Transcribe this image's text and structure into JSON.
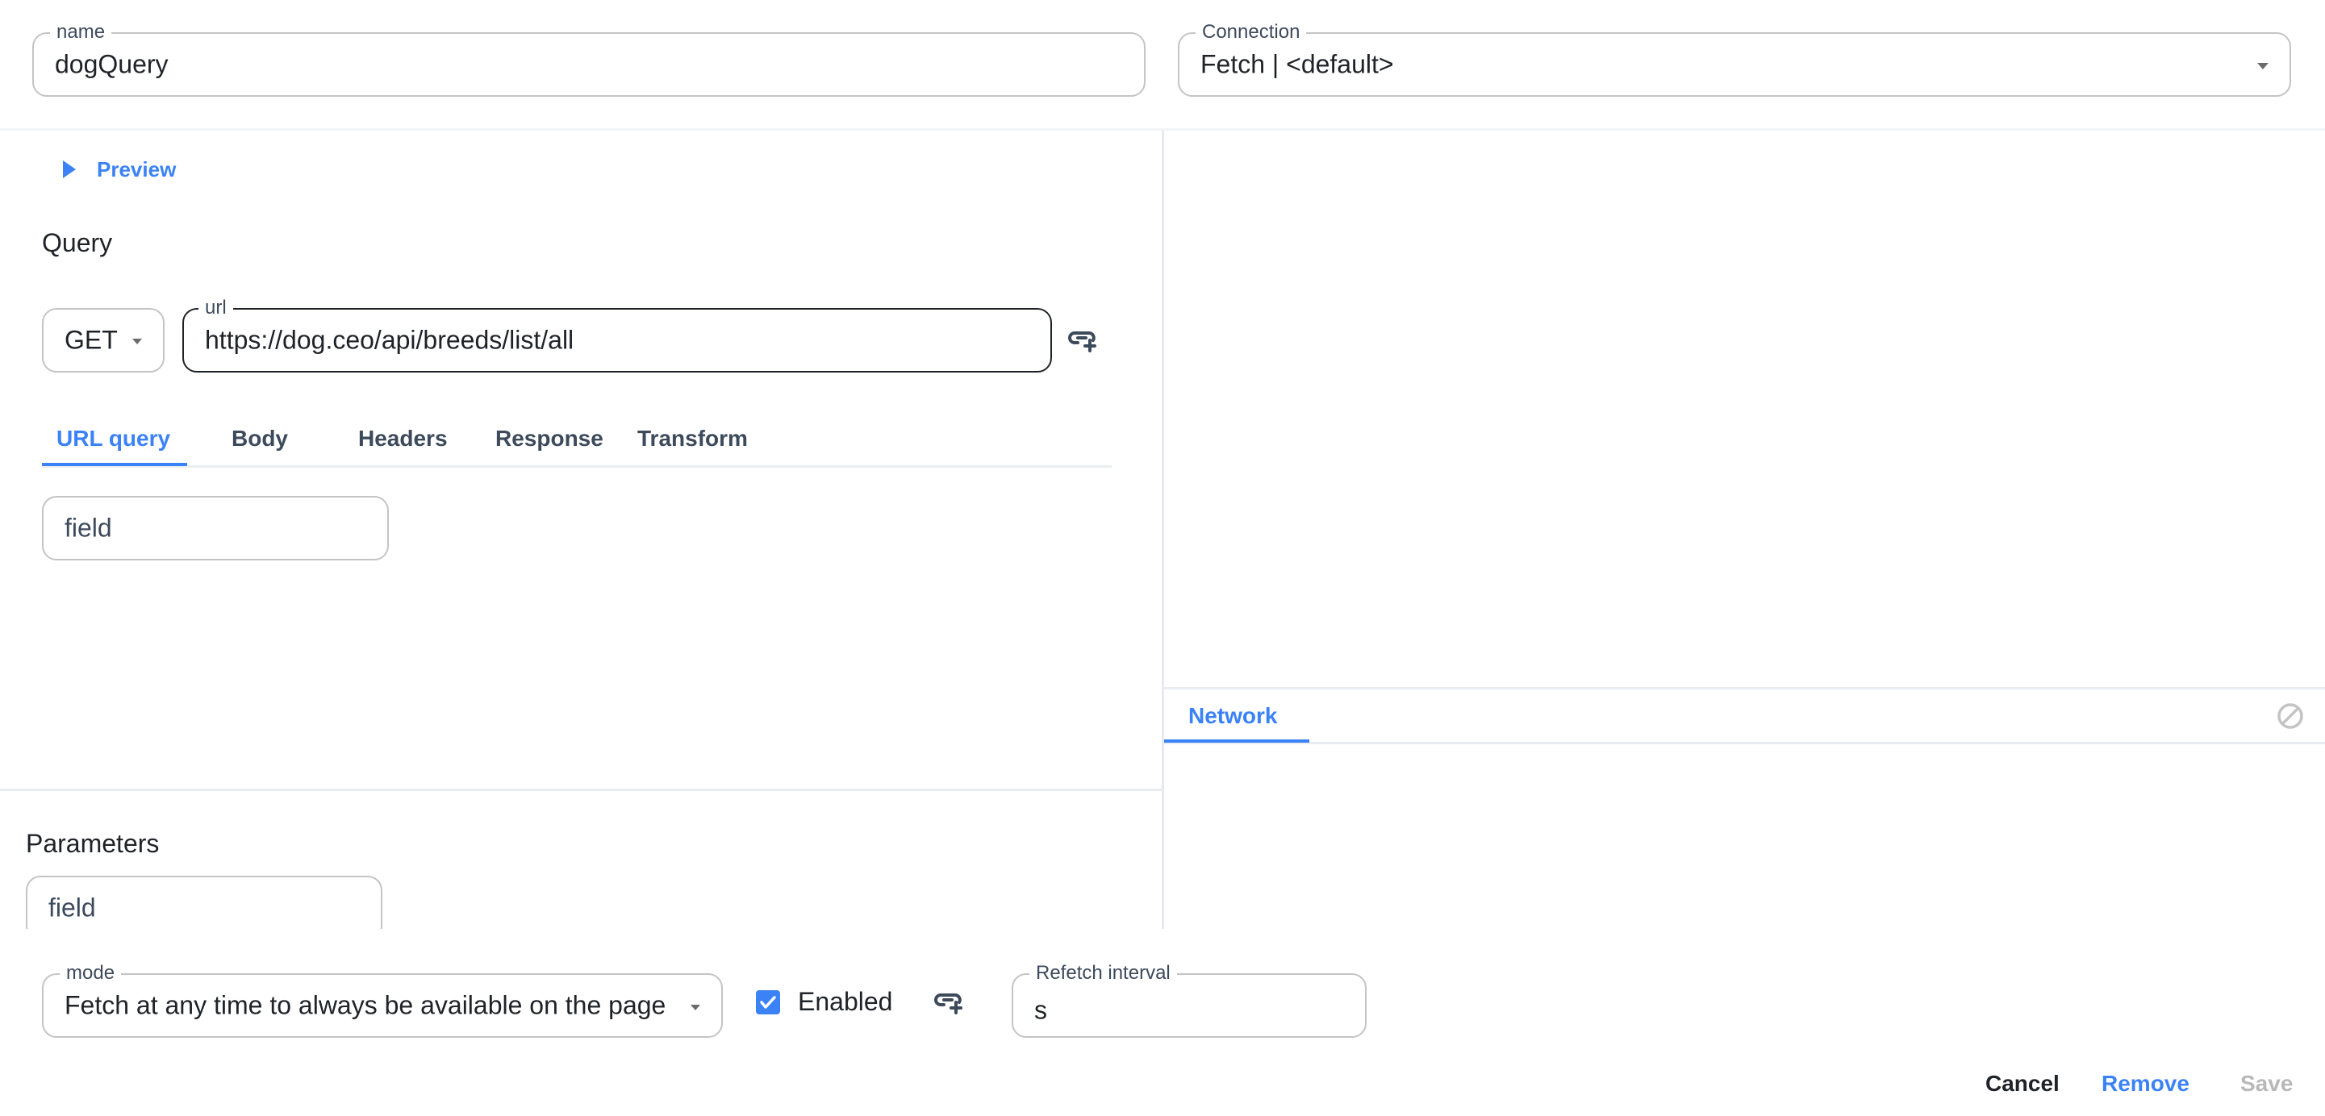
{
  "header": {
    "name_field": {
      "label": "name",
      "value": "dogQuery"
    },
    "connection_field": {
      "label": "Connection",
      "value": "Fetch | <default>"
    }
  },
  "editor": {
    "preview_label": "Preview",
    "query_title": "Query",
    "method": "GET",
    "url_field": {
      "label": "url",
      "value": "https://dog.ceo/api/breeds/list/all"
    },
    "tabs": [
      {
        "label": "URL query",
        "active": true
      },
      {
        "label": "Body",
        "active": false
      },
      {
        "label": "Headers",
        "active": false
      },
      {
        "label": "Response",
        "active": false
      },
      {
        "label": "Transform",
        "active": false
      }
    ],
    "url_query_field_placeholder": "field",
    "parameters_title": "Parameters",
    "parameters_field_placeholder": "field"
  },
  "devtools": {
    "tabs": [
      {
        "label": "Network",
        "active": true
      }
    ],
    "clear_icon": "block-icon"
  },
  "footer": {
    "mode_field": {
      "label": "mode",
      "value": "Fetch at any time to always be available on the page"
    },
    "enabled": {
      "label": "Enabled",
      "checked": true
    },
    "refetch_field": {
      "label": "Refetch interval",
      "value": "s"
    },
    "actions": {
      "cancel": "Cancel",
      "remove": "Remove",
      "save": "Save"
    }
  },
  "colors": {
    "accent": "#3b82f6",
    "text": "#1f2328",
    "muted_text": "#3d4a5c",
    "disabled": "#b8b8b8",
    "border": "#c4c4c4"
  }
}
